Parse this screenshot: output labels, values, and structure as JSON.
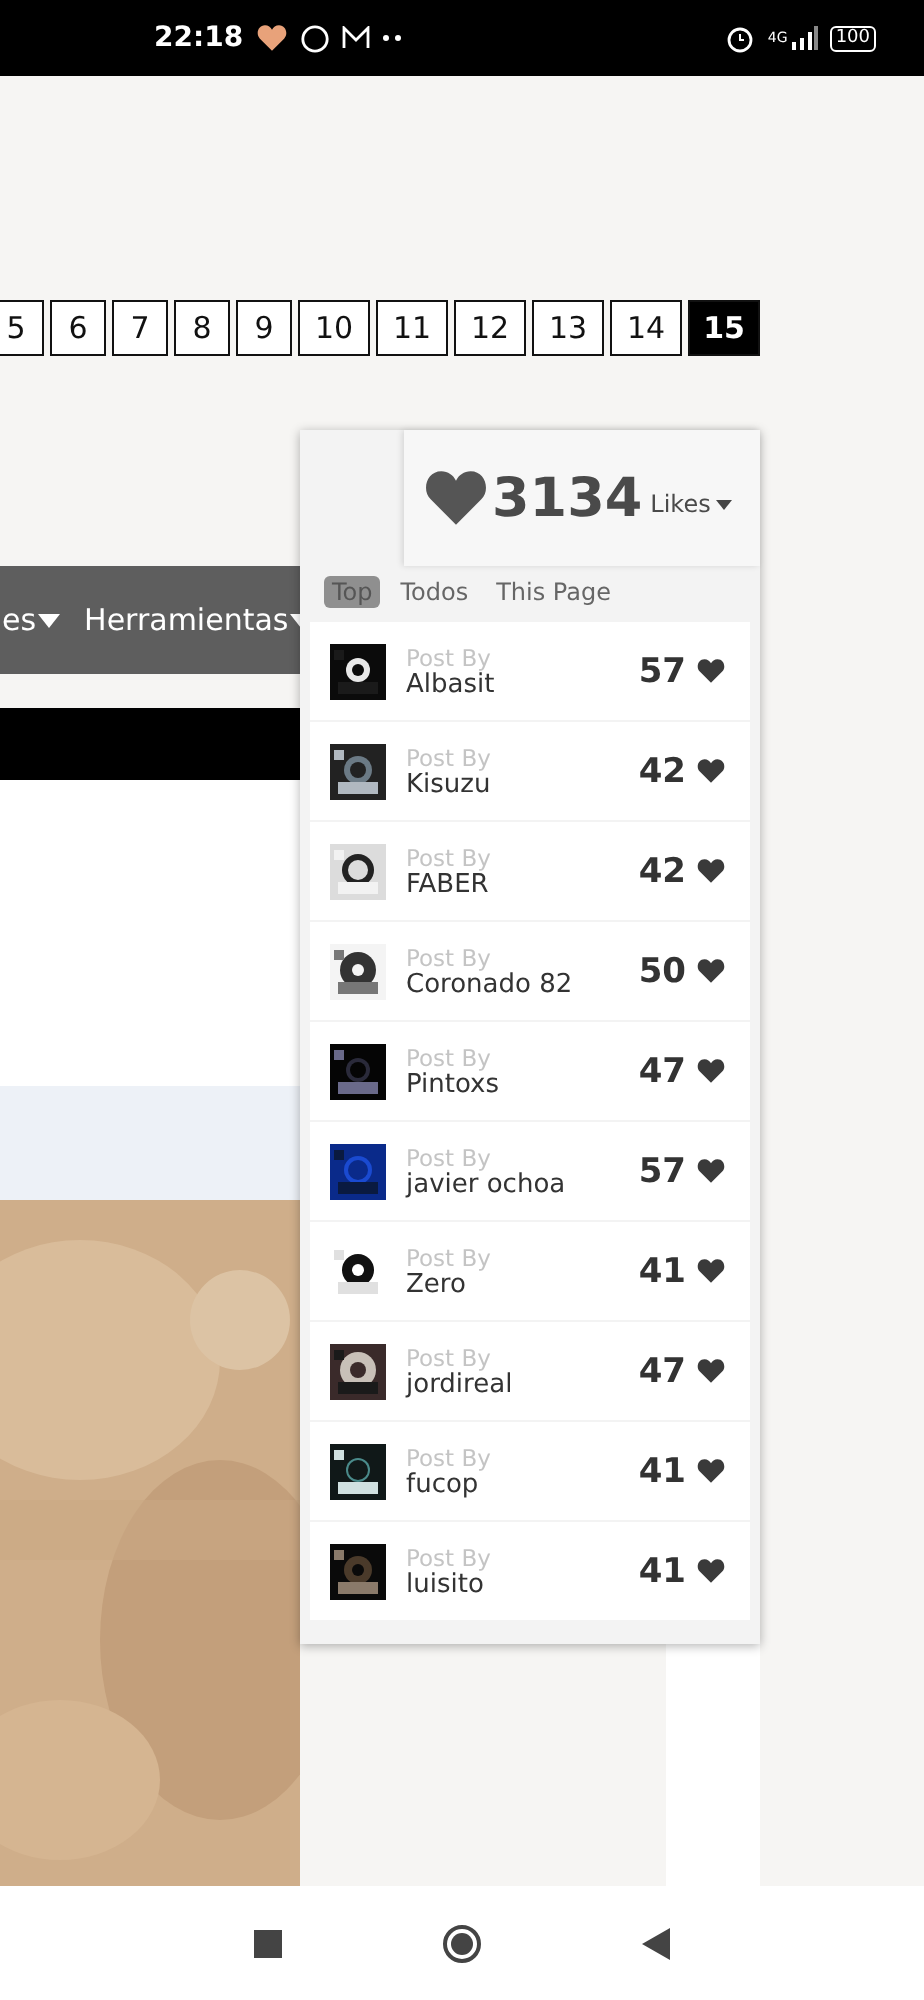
{
  "status_bar": {
    "time": "22:18",
    "network": "4G",
    "battery": "100"
  },
  "pagination": [
    {
      "label": "5",
      "selected": false
    },
    {
      "label": "6",
      "selected": false
    },
    {
      "label": "7",
      "selected": false
    },
    {
      "label": "8",
      "selected": false
    },
    {
      "label": "9",
      "selected": false
    },
    {
      "label": "10",
      "selected": false
    },
    {
      "label": "11",
      "selected": false
    },
    {
      "label": "12",
      "selected": false
    },
    {
      "label": "13",
      "selected": false
    },
    {
      "label": "14",
      "selected": false
    },
    {
      "label": "15",
      "selected": true
    }
  ],
  "nav_menu": [
    "es",
    "Herramientas"
  ],
  "likes_panel": {
    "total": "3134",
    "label": "Likes",
    "tabs": [
      {
        "label": "Top",
        "selected": true
      },
      {
        "label": "Todos",
        "selected": false
      },
      {
        "label": "This Page",
        "selected": false
      }
    ],
    "entries": [
      {
        "caption": "Post By",
        "name": "Albasit",
        "count": "57"
      },
      {
        "caption": "Post By",
        "name": "Kisuzu",
        "count": "42"
      },
      {
        "caption": "Post By",
        "name": "FABER",
        "count": "42"
      },
      {
        "caption": "Post By",
        "name": "Coronado 82",
        "count": "50"
      },
      {
        "caption": "Post By",
        "name": "Pintoxs",
        "count": "47"
      },
      {
        "caption": "Post By",
        "name": "javier ochoa",
        "count": "57"
      },
      {
        "caption": "Post By",
        "name": "Zero",
        "count": "41"
      },
      {
        "caption": "Post By",
        "name": "jordireal",
        "count": "47"
      },
      {
        "caption": "Post By",
        "name": "fucop",
        "count": "41"
      },
      {
        "caption": "Post By",
        "name": "luisito",
        "count": "41"
      }
    ]
  }
}
